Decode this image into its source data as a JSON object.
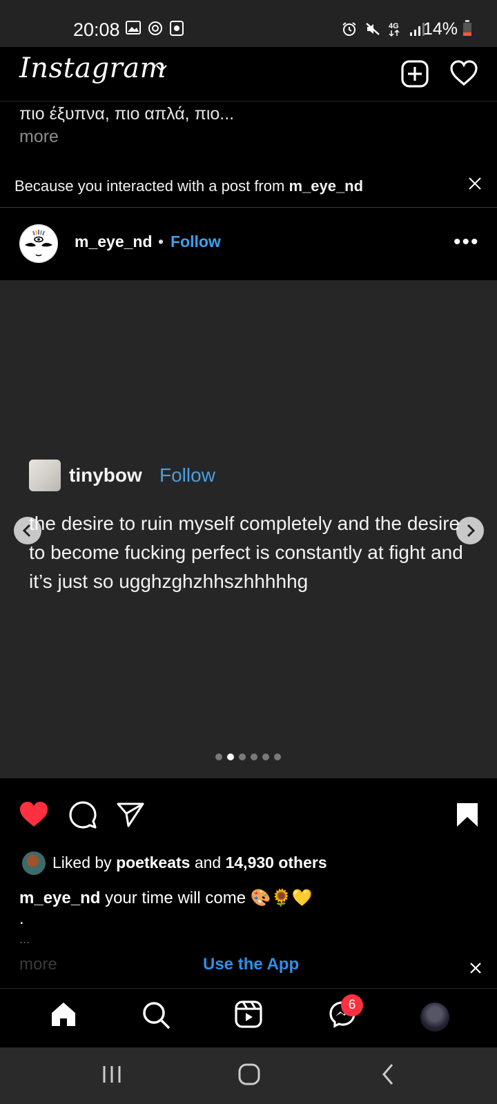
{
  "status_bar": {
    "time": "20:08",
    "battery": "14%",
    "icons_left": [
      "image-icon",
      "radio-icon",
      "record-icon"
    ],
    "icons_right": [
      "alarm-icon",
      "mute-icon",
      "4g-icon",
      "signal-icon",
      "battery-icon"
    ]
  },
  "header": {
    "logo": "Instagram",
    "icons": [
      "chevron-down-icon",
      "new-post-icon",
      "heart-icon"
    ]
  },
  "prev_caption": {
    "line": "πιο έξυπνα, πιο απλά, πιο...",
    "more": "more"
  },
  "suggestion": {
    "text": "Because you interacted with a post from ",
    "username": "m_eye_nd"
  },
  "post": {
    "username": "m_eye_nd",
    "separator": "•",
    "follow": "Follow",
    "more": "•••",
    "media": {
      "quote_user": "tinybow",
      "quote_follow": "Follow",
      "quote_text": "the desire to ruin myself completely and the desire to become fucking perfect is constantly at fight and it’s just so ugghzghzhhszhhhhhg",
      "slide_count": 6,
      "active_slide": 2
    },
    "liked_prefix": "Liked by ",
    "liked_user": "poetkeats",
    "liked_mid": " and ",
    "liked_count": "14,930 others",
    "caption_user": "m_eye_nd",
    "caption_text": " your time will come 🎨🌻💛",
    "caption_dot": ".",
    "caption_ellipsis": "...",
    "caption_more": "more"
  },
  "use_app": {
    "label": "Use the App"
  },
  "bottom_nav": {
    "items": [
      "home-icon",
      "search-icon",
      "reels-icon",
      "messenger-icon",
      "profile-avatar"
    ],
    "messages_badge": "6"
  },
  "colors": {
    "accent": "#3aa1f2",
    "like": "#ff3040",
    "media_bg": "#262626"
  }
}
